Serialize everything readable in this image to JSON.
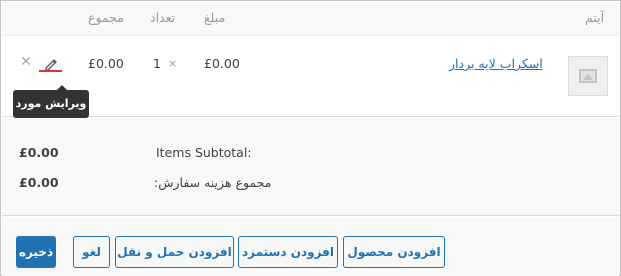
{
  "table_header": {
    "item": "آیتم",
    "cost": "مبلغ",
    "qty": "تعداد",
    "total": "مجموع"
  },
  "line_item": {
    "name": "اسکراب لایه بردار",
    "cost": "£0.00",
    "times": "×",
    "qty": "1",
    "total": "£0.00",
    "edit_icon": "pencil-icon",
    "delete_icon": "close-icon",
    "delete_glyph": "✕",
    "tooltip": "ویرایش مورد"
  },
  "totals": {
    "items_subtotal_label": "Items Subtotal:",
    "items_subtotal_value": "£0.00",
    "order_total_label": "مجموع هزینه سفارش:",
    "order_total_value": "£0.00"
  },
  "actions": {
    "save": "ذخیره",
    "cancel": "لغو",
    "add_shipping": "افزودن حمل و نقل",
    "add_fee": "افزودن دستمزد",
    "add_product": "افزودن محصول"
  },
  "colors": {
    "link": "#2271b1",
    "primary": "#2271b1",
    "danger": "#d63638",
    "tooltip_bg": "#333333"
  }
}
